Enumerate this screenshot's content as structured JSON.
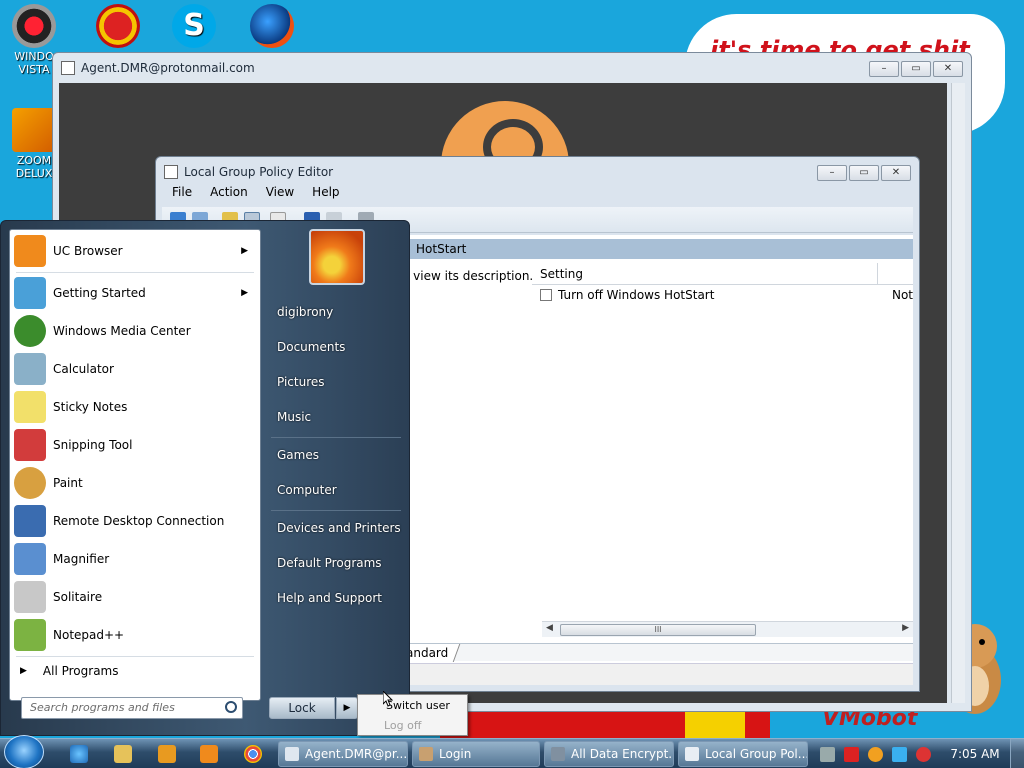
{
  "desktop": {
    "icons": [
      {
        "label": "WINDO\nVISTA",
        "icon": "windows-vista-icon"
      },
      {
        "label": "ZOOM\nDELUX",
        "icon": "zoom-icon"
      }
    ],
    "wallpaper_text": "it's time to get shit",
    "wallpaper_logo": "VMobot"
  },
  "back_window": {
    "title": "Agent.DMR@protonmail.com",
    "min": "–",
    "max": "▭",
    "close": "✕"
  },
  "gpe_window": {
    "title": "Local Group Policy Editor",
    "menu": [
      "File",
      "Action",
      "View",
      "Help"
    ],
    "header": "HotStart",
    "description": "o view its description.",
    "column_setting": "Setting",
    "row_label": "Turn off Windows HotStart",
    "row_state": "Not",
    "tab": "andard",
    "scroll_thumb": "III"
  },
  "start_menu": {
    "programs": [
      {
        "label": "UC Browser",
        "icon": "uc-browser-icon",
        "arrow": "▶",
        "color": "#f08a1c"
      },
      {
        "label": "Getting Started",
        "icon": "getting-started-icon",
        "arrow": "▶",
        "color": "#4aa0d8"
      },
      {
        "label": "Windows Media Center",
        "icon": "media-center-icon",
        "arrow": "",
        "color": "#3b8c2c"
      },
      {
        "label": "Calculator",
        "icon": "calculator-icon",
        "arrow": "",
        "color": "#8ab0c8"
      },
      {
        "label": "Sticky Notes",
        "icon": "sticky-notes-icon",
        "arrow": "",
        "color": "#f2e06a"
      },
      {
        "label": "Snipping Tool",
        "icon": "snipping-tool-icon",
        "arrow": "",
        "color": "#d23c3c"
      },
      {
        "label": "Paint",
        "icon": "paint-icon",
        "arrow": "",
        "color": "#d8a040"
      },
      {
        "label": "Remote Desktop Connection",
        "icon": "remote-desktop-icon",
        "arrow": "",
        "color": "#3a6cb0"
      },
      {
        "label": "Magnifier",
        "icon": "magnifier-icon",
        "arrow": "",
        "color": "#5a8fd0"
      },
      {
        "label": "Solitaire",
        "icon": "solitaire-icon",
        "arrow": "",
        "color": "#c8c8c8"
      },
      {
        "label": "Notepad++",
        "icon": "notepadpp-icon",
        "arrow": "",
        "color": "#7cb342"
      }
    ],
    "all_programs": "All Programs",
    "all_programs_arrow": "▶",
    "search_placeholder": "Search programs and files",
    "right_items_a": [
      "digibrony",
      "Documents",
      "Pictures",
      "Music"
    ],
    "right_items_b": [
      "Games",
      "Computer"
    ],
    "right_items_c": [
      "Devices and Printers",
      "Default Programs",
      "Help and Support"
    ],
    "lock": "Lock",
    "lock_arrow": "▶"
  },
  "power_popup": {
    "switch_user": "Switch user",
    "log_off": "Log off"
  },
  "taskbar": {
    "tasks": [
      {
        "label": "Agent.DMR@pr...",
        "icon": "window-icon",
        "color": "#dfe7ef"
      },
      {
        "label": "Login",
        "icon": "login-icon",
        "color": "#c8a070"
      },
      {
        "label": "All Data Encrypt...",
        "icon": "encrypt-icon",
        "color": "#8090a0"
      },
      {
        "label": "Local Group Pol...",
        "icon": "gpe-icon",
        "color": "#e8eef4"
      }
    ],
    "clock": "7:05 AM"
  }
}
